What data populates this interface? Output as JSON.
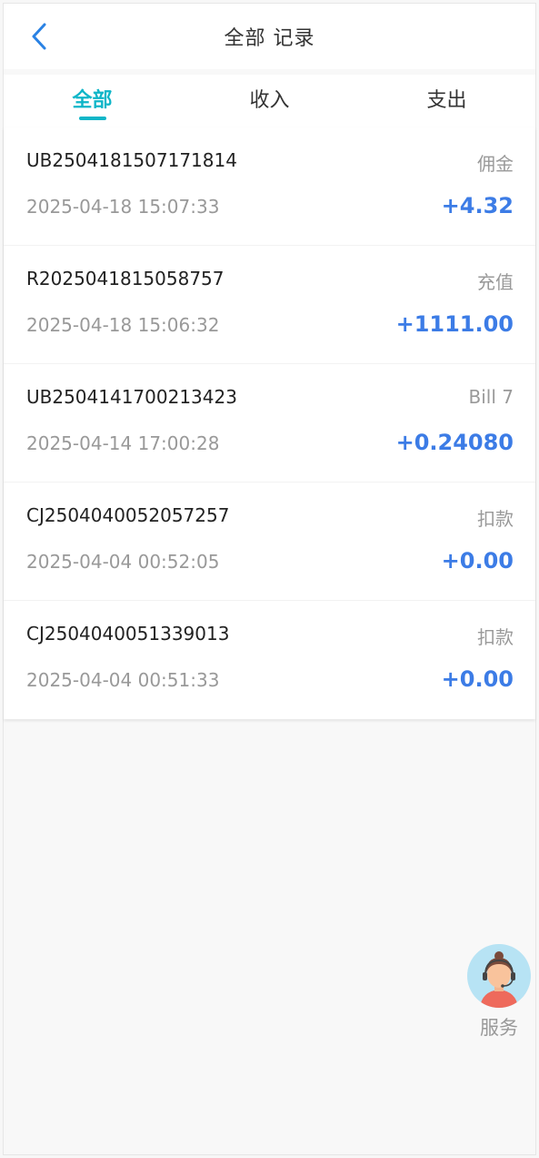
{
  "header": {
    "title": "全部 记录"
  },
  "tabs": [
    {
      "label": "全部",
      "active": true
    },
    {
      "label": "收入",
      "active": false
    },
    {
      "label": "支出",
      "active": false
    }
  ],
  "records": [
    {
      "id": "UB2504181507171814",
      "type": "佣金",
      "time": "2025-04-18 15:07:33",
      "amount": "+4.32"
    },
    {
      "id": "R2025041815058757",
      "type": "充值",
      "time": "2025-04-18 15:06:32",
      "amount": "+1111.00"
    },
    {
      "id": "UB2504141700213423",
      "type": "Bill 7",
      "time": "2025-04-14 17:00:28",
      "amount": "+0.24080"
    },
    {
      "id": "CJ2504040052057257",
      "type": "扣款",
      "time": "2025-04-04 00:52:05",
      "amount": "+0.00"
    },
    {
      "id": "CJ2504040051339013",
      "type": "扣款",
      "time": "2025-04-04 00:51:33",
      "amount": "+0.00"
    }
  ],
  "service": {
    "label": "服务",
    "icon": "customer-service-icon"
  },
  "colors": {
    "accent": "#0fb6c8",
    "amount": "#3c7ce6",
    "back": "#2a82e4"
  }
}
